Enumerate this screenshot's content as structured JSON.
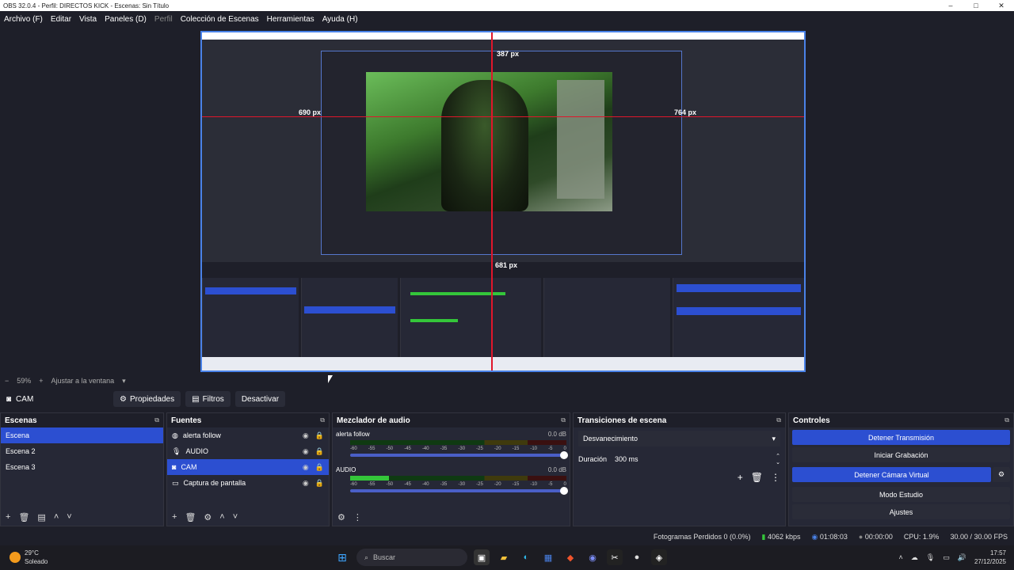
{
  "window": {
    "title": "OBS 32.0.4 - Perfil: DIRECTOS KICK - Escenas: Sin Título",
    "controls": [
      "–",
      "□",
      "✕"
    ]
  },
  "menu": [
    "Archivo (F)",
    "Editar",
    "Vista",
    "Paneles (D)",
    "Perfil",
    "Colección de Escenas",
    "Herramientas",
    "Ayuda (H)"
  ],
  "preview": {
    "guide_left": "690 px",
    "guide_right": "764 px",
    "guide_top": "387 px",
    "guide_bottom": "681 px",
    "zoom": "59%",
    "fit_label": "Ajustar a la ventana"
  },
  "source_toolbar": {
    "current_source": "CAM",
    "properties": "Propiedades",
    "filters": "Filtros",
    "deactivate": "Desactivar"
  },
  "scenes": {
    "title": "Escenas",
    "items": [
      "Escena",
      "Escena 2",
      "Escena 3"
    ],
    "selected": "Escena"
  },
  "sources": {
    "title": "Fuentes",
    "items": [
      {
        "label": "alerta follow",
        "icon": "browser-icon"
      },
      {
        "label": "AUDIO",
        "icon": "microphone-icon"
      },
      {
        "label": "CAM",
        "icon": "camera-icon"
      },
      {
        "label": "Captura de pantalla",
        "icon": "monitor-icon"
      }
    ],
    "selected": "CAM"
  },
  "mixer": {
    "title": "Mezclador de audio",
    "ticks": [
      "-60",
      "-55",
      "-50",
      "-45",
      "-40",
      "-35",
      "-30",
      "-25",
      "-20",
      "-15",
      "-10",
      "-5",
      "0"
    ],
    "channels": [
      {
        "name": "alerta follow",
        "db": "0.0 dB",
        "level": 0.0
      },
      {
        "name": "AUDIO",
        "db": "0.0 dB",
        "level": 0.18
      }
    ]
  },
  "transitions": {
    "title": "Transiciones de escena",
    "selected": "Desvanecimiento",
    "duration_label": "Duración",
    "duration_value": "300 ms"
  },
  "controls": {
    "title": "Controles",
    "stop_stream": "Detener Transmisión",
    "start_recording": "Iniciar Grabación",
    "stop_virtual_cam": "Detener Cámara Virtual",
    "studio_mode": "Modo Estudio",
    "settings": "Ajustes"
  },
  "status": {
    "dropped_frames": "Fotogramas Perdidos 0 (0.0%)",
    "bitrate": "4062 kbps",
    "stream_time": "01:08:03",
    "rec_time": "00:00:00",
    "cpu": "CPU: 1.9%",
    "fps": "30.00 / 30.00 FPS"
  },
  "taskbar": {
    "temp": "29°C",
    "weather": "Soleado",
    "search": "Buscar",
    "time": "17:57",
    "date": "27/12/2025"
  },
  "colors": {
    "accent": "#2c4fd1",
    "guide": "#e0162b",
    "background": "#1e1f29"
  }
}
